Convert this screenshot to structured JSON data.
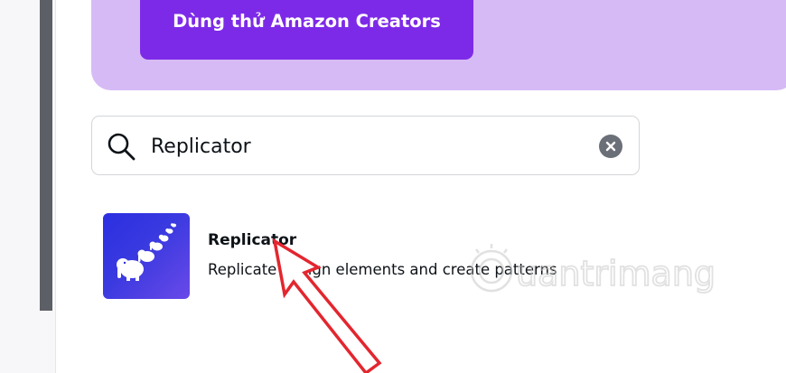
{
  "promo": {
    "button_label": "Dùng thử Amazon Creators"
  },
  "search": {
    "value": "Replicator",
    "placeholder": "Replicator",
    "search_icon": "search-icon",
    "clear_icon": "clear-icon"
  },
  "results": [
    {
      "title": "Replicator",
      "description": "Replicate design elements and create patterns",
      "icon": "replicator-app-icon"
    }
  ],
  "watermark": {
    "text": "uantrimang",
    "icon": "quantrimang-logo-icon"
  },
  "annotation": {
    "icon": "red-arrow-icon"
  },
  "colors": {
    "promo_banner": "#d6baf6",
    "promo_button": "#7d2ae8",
    "app_gradient_start": "#2b2fe0",
    "app_gradient_end": "#6a49e8",
    "annotation_arrow": "#e3262f"
  }
}
